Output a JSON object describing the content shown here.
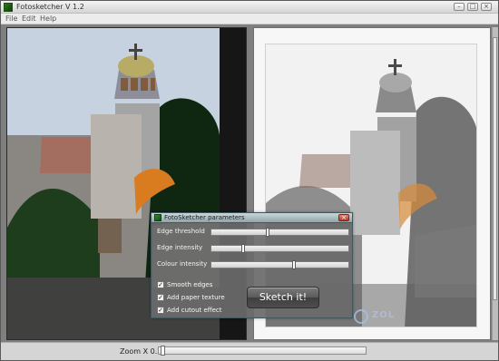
{
  "window": {
    "title": "Fotosketcher V 1.2"
  },
  "menu": [
    "File",
    "Edit",
    "Help"
  ],
  "zoom": {
    "label": "Zoom X 0.27",
    "value": 0.27
  },
  "dialog": {
    "title": "FotoSketcher parameters",
    "parameters": [
      {
        "label": "Edge threshold",
        "value": 0.42
      },
      {
        "label": "Edge intensity",
        "value": 0.24
      },
      {
        "label": "Colour intensity",
        "value": 0.6
      }
    ],
    "options": [
      {
        "label": "Smooth edges",
        "checked": true
      },
      {
        "label": "Add paper texture",
        "checked": true
      },
      {
        "label": "Add cutout effect",
        "checked": true
      }
    ],
    "action_label": "Sketch it!"
  },
  "watermark": "ZOL",
  "icons": {
    "app": "app-icon",
    "minimize": "minimize-icon",
    "maximize": "maximize-icon",
    "close": "close-icon",
    "dialog_close": "close-icon"
  },
  "colors": {
    "titlebar": "#d7d7d7",
    "dialog": "#6a6a6a",
    "accent": "#2f8f2d",
    "close": "#b33a2d"
  }
}
